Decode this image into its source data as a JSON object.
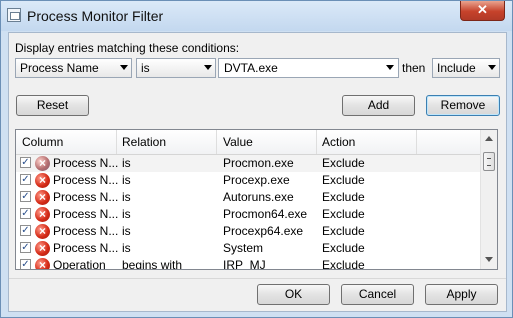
{
  "window": {
    "title": "Process Monitor Filter",
    "close_label": "✕"
  },
  "filter": {
    "label": "Display entries matching these conditions:",
    "column": "Process Name",
    "relation": "is",
    "value": "DVTA.exe",
    "then_label": "then",
    "action": "Include"
  },
  "buttons": {
    "reset": "Reset",
    "add": "Add",
    "remove": "Remove",
    "ok": "OK",
    "cancel": "Cancel",
    "apply": "Apply"
  },
  "table": {
    "headers": [
      "Column",
      "Relation",
      "Value",
      "Action"
    ],
    "rows": [
      {
        "column": "Process N...",
        "relation": "is",
        "value": "Procmon.exe",
        "action": "Exclude",
        "checked": true,
        "icon": "exclude-icon"
      },
      {
        "column": "Process N...",
        "relation": "is",
        "value": "Procexp.exe",
        "action": "Exclude",
        "checked": true,
        "icon": "exclude-icon"
      },
      {
        "column": "Process N...",
        "relation": "is",
        "value": "Autoruns.exe",
        "action": "Exclude",
        "checked": true,
        "icon": "exclude-icon"
      },
      {
        "column": "Process N...",
        "relation": "is",
        "value": "Procmon64.exe",
        "action": "Exclude",
        "checked": true,
        "icon": "exclude-icon"
      },
      {
        "column": "Process N...",
        "relation": "is",
        "value": "Procexp64.exe",
        "action": "Exclude",
        "checked": true,
        "icon": "exclude-icon"
      },
      {
        "column": "Process N...",
        "relation": "is",
        "value": "System",
        "action": "Exclude",
        "checked": true,
        "icon": "exclude-icon"
      },
      {
        "column": "Operation",
        "relation": "begins with",
        "value": "IRP_MJ_",
        "action": "Exclude",
        "checked": true,
        "icon": "exclude-icon"
      }
    ]
  }
}
